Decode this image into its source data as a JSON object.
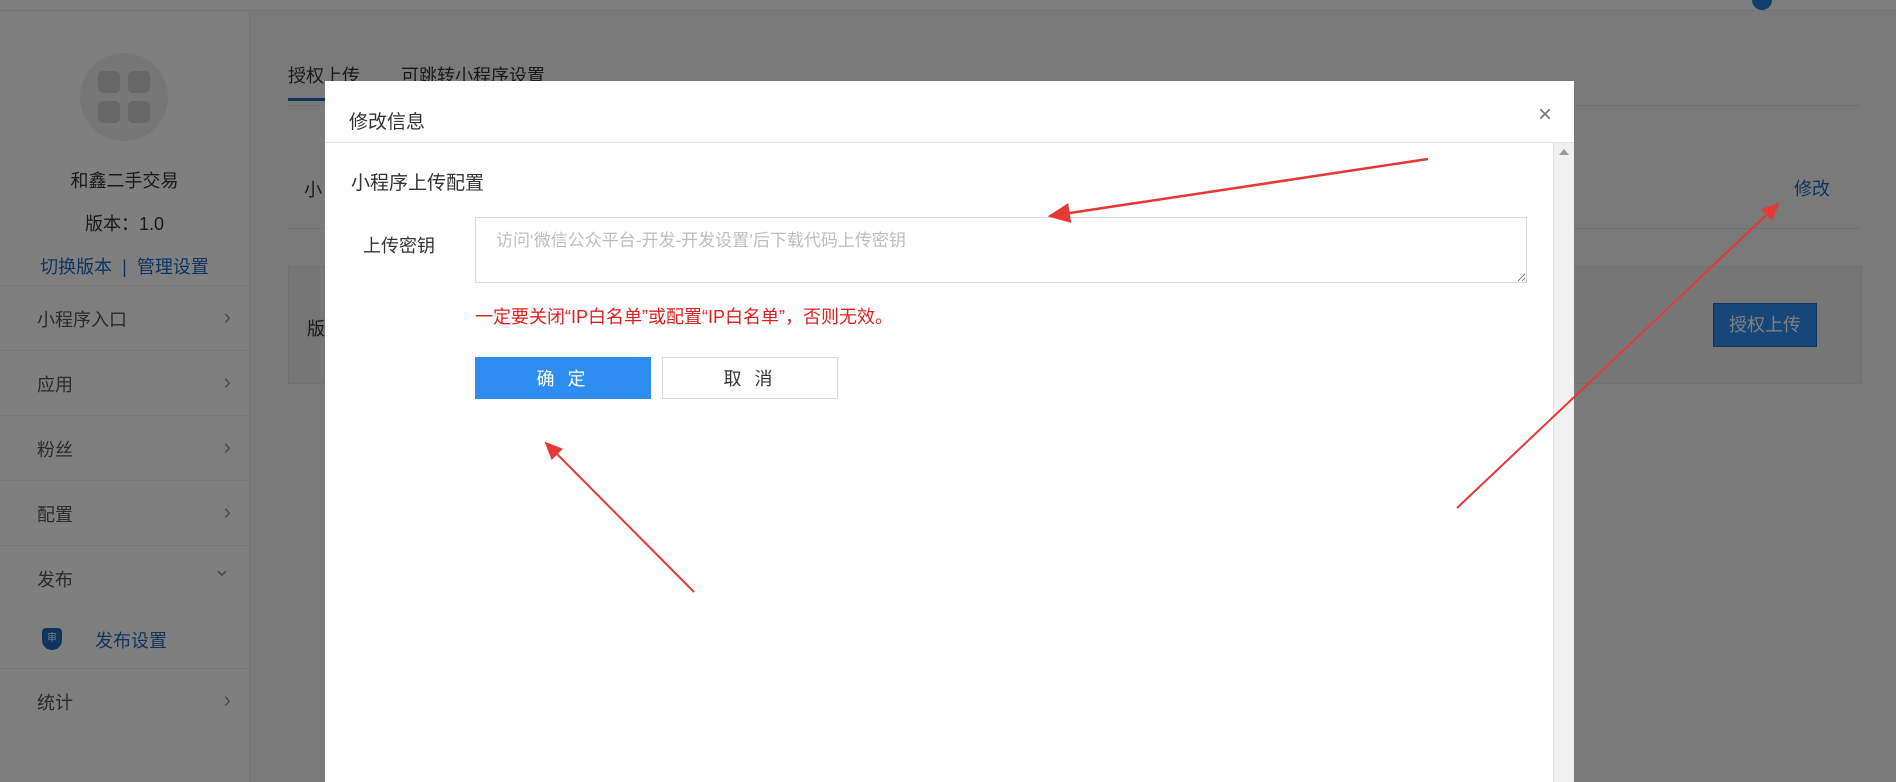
{
  "app": {
    "name": "和鑫二手交易",
    "version": "版本：1.0",
    "switch_version": "切换版本",
    "separator": "|",
    "manage_settings": "管理设置"
  },
  "sidebar": {
    "items": [
      {
        "label": "小程序入口",
        "icon": "chevron-right-icon"
      },
      {
        "label": "应用",
        "icon": "chevron-right-icon"
      },
      {
        "label": "粉丝",
        "icon": "chevron-right-icon"
      },
      {
        "label": "配置",
        "icon": "chevron-right-icon"
      },
      {
        "label": "发布",
        "icon": "chevron-down-icon"
      }
    ],
    "sub_item": {
      "label": "发布设置",
      "badge": "审",
      "icon": "shield-icon"
    },
    "last_item": {
      "label": "统计",
      "icon": "chevron-right-icon"
    },
    "chevron_right": "›",
    "chevron_down": "⌄"
  },
  "main": {
    "tabs": [
      {
        "label": "授权上传",
        "active": true
      },
      {
        "label": "可跳转小程序设置",
        "active": false
      }
    ],
    "card1": {
      "label": "小",
      "edit": "修改"
    },
    "card2": {
      "label": "版",
      "button": "授权上传"
    }
  },
  "modal": {
    "title": "修改信息",
    "close": "×",
    "section_title": "小程序上传配置",
    "field_label": "上传密钥",
    "field_placeholder": "访问‘微信公众平台-开发-开发设置’后下载代码上传密钥",
    "field_value": "",
    "warning": "一定要关闭“IP白名单”或配置“IP白名单”，否则无效。",
    "ok_button": "确 定",
    "cancel_button": "取 消"
  },
  "colors": {
    "accent": "#2e8df0",
    "link": "#1e6bbf",
    "warning": "#e02020",
    "annotation_arrow": "#e53935"
  }
}
